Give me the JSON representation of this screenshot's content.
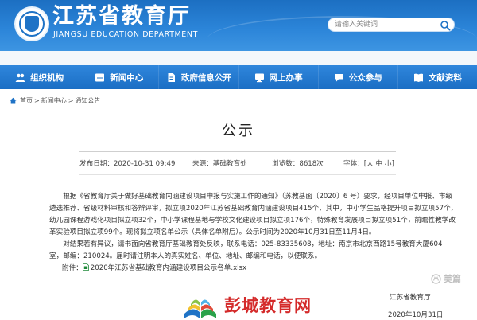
{
  "header": {
    "title": "江苏省教育厅",
    "subtitle": "JIANGSU EDUCATION DEPARTMENT",
    "search_placeholder": "请输入关键词",
    "colors": {
      "header_blue": "#2b84d8",
      "nav_blue": "#1f73c6"
    }
  },
  "nav": {
    "items": [
      {
        "label": "组织机构",
        "icon": "people-icon"
      },
      {
        "label": "新闻中心",
        "icon": "news-icon"
      },
      {
        "label": "政府信息公开",
        "icon": "document-icon"
      },
      {
        "label": "网上办事",
        "icon": "monitor-icon"
      },
      {
        "label": "公众参与",
        "icon": "chat-icon"
      },
      {
        "label": "文献资料",
        "icon": "book-icon"
      }
    ]
  },
  "breadcrumb": {
    "home": "首页",
    "section": "新闻中心",
    "current": "通知公告",
    "separator": ">"
  },
  "article": {
    "title": "公示",
    "published": "发布日期：2020-10-31 09:49",
    "source": "来源：基础教育处",
    "views": "浏览数：8618次",
    "font_label": "字体：",
    "font_open": "[",
    "font_large": "大",
    "font_medium": "中",
    "font_small": "小",
    "font_close": "]",
    "paragraphs": [
      "根据《省教育厅关于做好基础教育内涵建设项目申报与实施工作的通知》（苏教基函〔2020〕6 号）要求，经项目单位申报、市级遴选推荐、省级材料审核和答辩评审，拟立项2020年江苏省基础教育内涵建设项目415个，其中，中小学生品格提升项目拟立项57个，幼儿园课程游戏化项目拟立项32个，中小学课程基地与学校文化建设项目拟立项176个，特殊教育发展项目拟立项51个，前瞻性教学改革实验项目拟立项99个。现将拟立项名单公示（具体名单附后）。公示时间为2020年10月31日至11月4日。",
      "对结果若有异议，请书面向省教育厅基础教育处反映，联系电话：025-83335608，地址：南京市北京西路15号教育大厦604室，邮编：210024。届时请注明本人的真实姓名、单位、地址、邮编和电话，以便联系。"
    ],
    "attachment_label": "附件：",
    "attachment_name": "2020年江苏省基础教育内涵建设项目公示名单.xlsx",
    "sign_org": "江苏省教育厅",
    "sign_date": "2020年10月31日"
  },
  "watermarks": {
    "bottom_brand": "彭城教育网",
    "corner_brand": "美篇"
  }
}
